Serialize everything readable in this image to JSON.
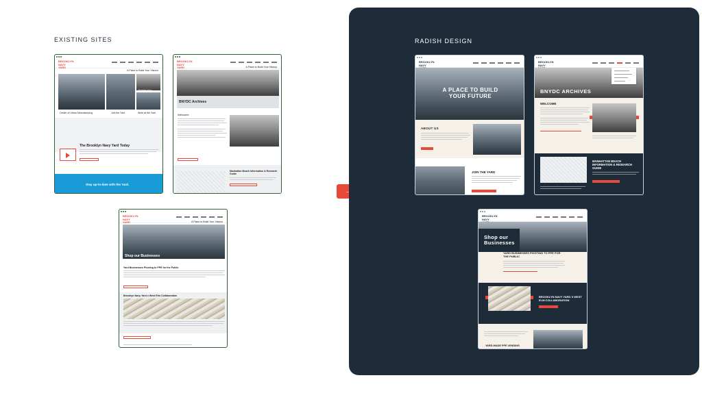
{
  "headings": {
    "existing_sites": "EXISTING SITES",
    "radish_design": "RADISH DESIGN"
  },
  "arrow_icon": "→",
  "existing": {
    "site1": {
      "logo": "BROOKLYN NAVY YARD",
      "tagline": "A Place to Build Your Visions",
      "tile_visit": "Visit the Yard",
      "tile_center": "Center of Urban Manufacturing",
      "tile_join": "Join the Yard",
      "tile_work": "Work at the Yard",
      "section_title": "The Brooklyn Navy Yard Today",
      "footer": "Stay up-to-date with the Yard."
    },
    "site2": {
      "logo": "BROOKLYN NAVY YARD",
      "tagline": "A Place to Build Your History",
      "hero_title": "BNYDC Archives",
      "welcome": "Welcome",
      "research_title": "Manhattan Beach Information & Research Guide"
    },
    "site3": {
      "logo": "BROOKLYN NAVY YARD",
      "tagline": "A Place to Build Your Visions",
      "hero_title": "Shop our Businesses",
      "article1": "Yard Businesses Pivoting to PPE for the Public",
      "article2": "Brooklyn Navy Yard x West Elm Collaboration"
    }
  },
  "radish": {
    "home": {
      "logo": "BROOKLYN NAVY YARD",
      "hero": "A PLACE TO BUILD YOUR FUTURE",
      "about": "ABOUT US",
      "join": "JOIN THE YARD"
    },
    "archives": {
      "logo": "BROOKLYN NAVY YARD",
      "hero": "BNYDC ARCHIVES",
      "welcome": "WELCOME",
      "research": "MANHATTAN BEACH INFORMATION & RESEARCH GUIDE"
    },
    "shop": {
      "logo": "BROOKLYN NAVY YARD",
      "hero": "Shop our Businesses",
      "article1": "YARD BUSINESSES PIVOTING TO PPE FOR THE PUBLIC",
      "article2": "BROOKLYN NAVY YARD X WEST ELM COLLABORATION",
      "article3": "YARD-MADE PPE VENDING"
    }
  },
  "colors": {
    "accent": "#e84a3a",
    "panel": "#1e2c3a",
    "frame_green": "#2f5e33",
    "cta_blue": "#1a9ad6"
  }
}
